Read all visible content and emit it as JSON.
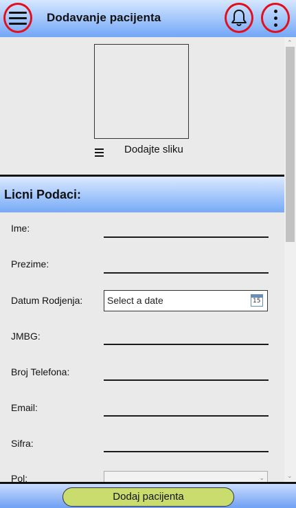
{
  "header": {
    "title": "Dodavanje pacijenta",
    "menu_icon": "hamburger-menu-icon",
    "notification_icon": "bell-icon",
    "more_icon": "kebab-menu-icon"
  },
  "photo": {
    "label": "Dodajte sliku",
    "menu_icon": "hamburger-menu-icon"
  },
  "section": {
    "title": "Licni Podaci:"
  },
  "form": {
    "ime_label": "Ime:",
    "prezime_label": "Prezime:",
    "datum_label": "Datum Rodjenja:",
    "datum_placeholder": "Select a date",
    "jmbg_label": "JMBG:",
    "telefon_label": "Broj Telefona:",
    "email_label": "Email:",
    "sifra_label": "Sifra:",
    "pol_label": "Pol:",
    "pol_value": ""
  },
  "footer": {
    "add_button_label": "Dodaj pacijenta"
  },
  "colors": {
    "header_gradient_top": "#d6e7ff",
    "header_gradient_bottom": "#73a7f7",
    "highlight_ring": "#e0101c",
    "button_fill": "#c9dc6d",
    "content_background": "#eaeaea"
  }
}
